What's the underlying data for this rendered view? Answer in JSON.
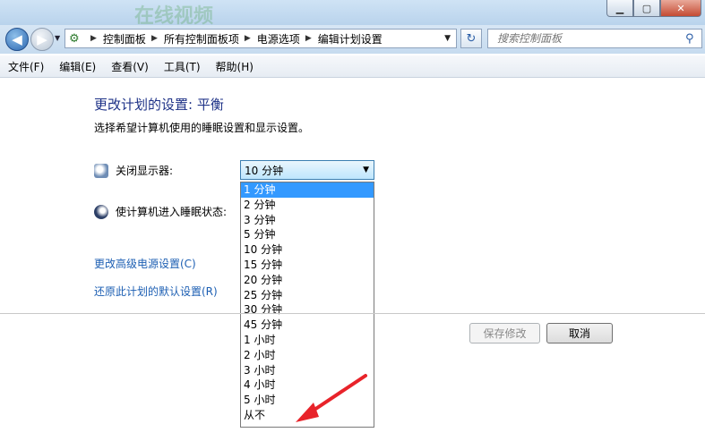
{
  "window": {
    "watermark": "在线视频",
    "minimize": "▁",
    "maximize": "▢",
    "close": "✕"
  },
  "nav": {
    "breadcrumbs": [
      "控制面板",
      "所有控制面板项",
      "电源选项",
      "编辑计划设置"
    ],
    "search_placeholder": "搜索控制面板"
  },
  "menu": [
    "文件(F)",
    "编辑(E)",
    "查看(V)",
    "工具(T)",
    "帮助(H)"
  ],
  "main": {
    "title": "更改计划的设置: 平衡",
    "subtitle": "选择希望计算机使用的睡眠设置和显示设置。",
    "display_off_label": "关闭显示器:",
    "sleep_label": "使计算机进入睡眠状态:",
    "display_off_value": "10 分钟",
    "dropdown_options": [
      "1 分钟",
      "2 分钟",
      "3 分钟",
      "5 分钟",
      "10 分钟",
      "15 分钟",
      "20 分钟",
      "25 分钟",
      "30 分钟",
      "45 分钟",
      "1 小时",
      "2 小时",
      "3 小时",
      "4 小时",
      "5 小时",
      "从不"
    ],
    "highlighted_option": "1 分钟",
    "advanced_link": "更改高级电源设置(C)",
    "restore_link": "还原此计划的默认设置(R)",
    "save_label": "保存修改",
    "cancel_label": "取消"
  },
  "annotation": {
    "color": "#e8232a"
  }
}
